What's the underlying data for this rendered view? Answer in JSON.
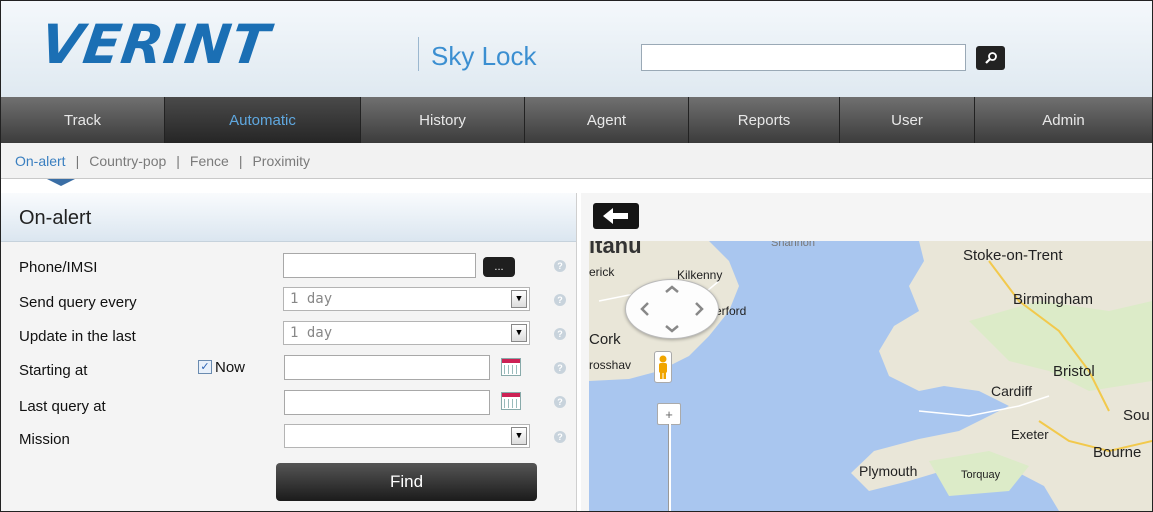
{
  "header": {
    "brand": "VERINT",
    "product": "Sky Lock",
    "search_value": "",
    "search_icon": "search-icon"
  },
  "nav": {
    "tabs": [
      {
        "label": "Track",
        "active": false
      },
      {
        "label": "Automatic",
        "active": true
      },
      {
        "label": "History",
        "active": false
      },
      {
        "label": "Agent",
        "active": false
      },
      {
        "label": "Reports",
        "active": false
      },
      {
        "label": "User",
        "active": false
      },
      {
        "label": "Admin",
        "active": false
      }
    ]
  },
  "subnav": {
    "items": [
      "On-alert",
      "Country-pop",
      "Fence",
      "Proximity"
    ],
    "separator": "|",
    "active": "On-alert"
  },
  "form": {
    "title": "On-alert",
    "phone_label": "Phone/IMSI",
    "phone_value": "",
    "phone_button": "...",
    "send_label": "Send query every",
    "send_value": "1 day",
    "update_label": "Update in the last",
    "update_value": "1 day",
    "starting_label": "Starting at",
    "now_label": "Now",
    "now_checked": true,
    "starting_value": "",
    "last_label": "Last query at",
    "last_value": "",
    "mission_label": "Mission",
    "mission_value": "",
    "find_label": "Find",
    "help_glyph": "?"
  },
  "map": {
    "back_icon": "arrow-left-icon",
    "zoom_in": "+",
    "places": [
      "Stoke-on-Trent",
      "Birmingham",
      "Bristol",
      "Cardiff",
      "Exeter",
      "Plymouth",
      "Torquay",
      "Cork",
      "Kilkenny",
      "erford",
      "erick",
      "rosshav",
      "Sou",
      "Bourne",
      "Shannon"
    ]
  },
  "colors": {
    "brand_blue": "#1b6fb4",
    "active_tab_text": "#5fa8e0",
    "nav_bg": "#4a4a4a",
    "sea": "#a9c6ef",
    "land": "#e9e6d8"
  }
}
